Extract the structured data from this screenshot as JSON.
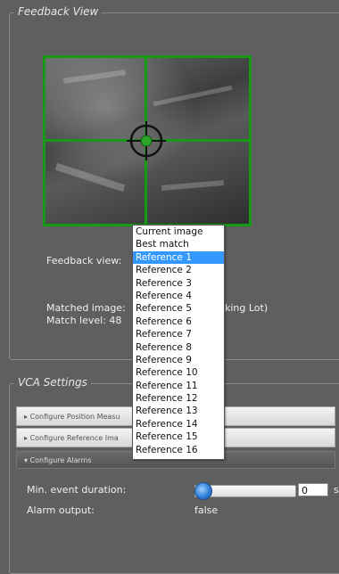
{
  "feedback_panel": {
    "legend": "Feedback View",
    "feedback_view_label": "Feedback view:",
    "matched_image_label": "Matched image:",
    "matched_image_suffix": "king Lot)",
    "match_level_label": "Match level: 48"
  },
  "dropdown": {
    "options": [
      "Current image",
      "Best match",
      "Reference 1",
      "Reference 2",
      "Reference 3",
      "Reference 4",
      "Reference 5",
      "Reference 6",
      "Reference 7",
      "Reference 8",
      "Reference 9",
      "Reference 10",
      "Reference 11",
      "Reference 12",
      "Reference 13",
      "Reference 14",
      "Reference 15",
      "Reference 16"
    ],
    "selected": "Reference 1"
  },
  "vca_panel": {
    "legend": "VCA Settings",
    "sections": [
      {
        "label": "Configure Position Measu"
      },
      {
        "label": "Configure Reference Ima"
      },
      {
        "label": "Configure Alarms"
      }
    ],
    "min_event_label": "Min. event duration:",
    "min_event_value": "0",
    "min_event_unit_partial": "s",
    "alarm_output_label": "Alarm output:",
    "alarm_output_value": "false",
    "slider_level": 0
  },
  "colors": {
    "overlay_green": "#149a14",
    "selection_blue": "#3399ff",
    "background": "#5f5f5f"
  }
}
